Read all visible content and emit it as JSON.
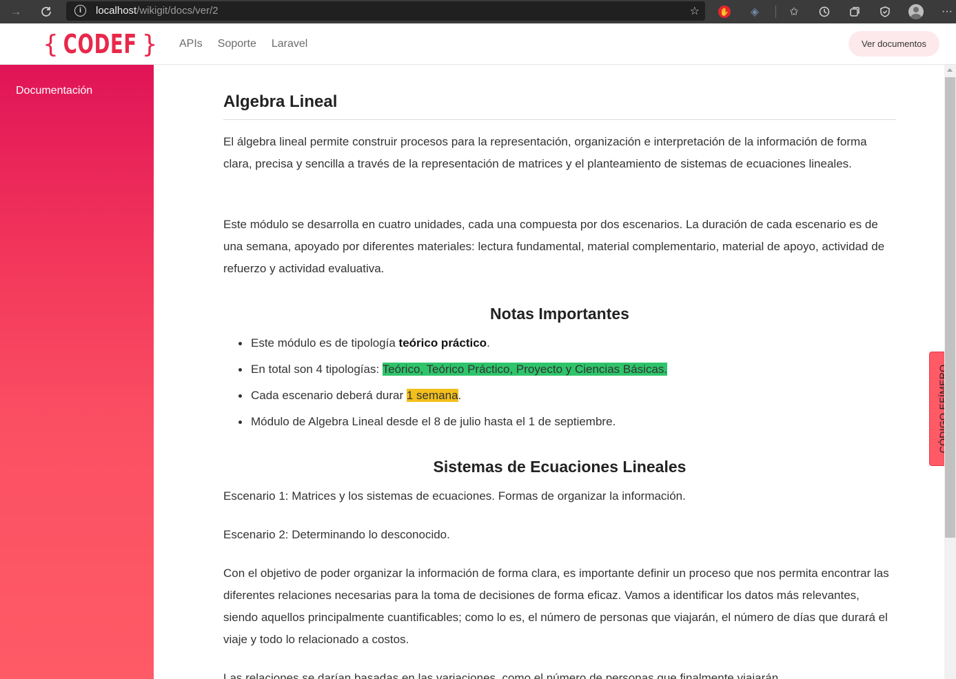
{
  "browser": {
    "url_host": "localhost",
    "url_path": "/wikigit/docs/ver/2",
    "info_icon": "i"
  },
  "header": {
    "logo_text": "CODEF",
    "nav": [
      "APIs",
      "Soporte",
      "Laravel"
    ],
    "ver_documentos": "Ver documentos"
  },
  "sidebar": {
    "items": [
      "Documentación"
    ]
  },
  "side_tab": "CÓDIGO EFÍMERO",
  "main": {
    "title": "Algebra Lineal",
    "intro": "El álgebra lineal permite construir procesos para la representación, organización e interpretación de la información de forma clara, precisa y sencilla a través de la representación de matrices y el planteamiento de sistemas de ecuaciones lineales.",
    "modulo": "Este módulo se desarrolla en cuatro unidades, cada una compuesta por dos escenarios. La duración de cada escenario es de una semana, apoyado por diferentes materiales: lectura fundamental, material complementario, material de apoyo, actividad de refuerzo  y actividad evaluativa.",
    "notas_title": "Notas Importantes",
    "notas": {
      "n1_pre": "Este módulo es de tipología ",
      "n1_bold": "teórico práctico",
      "n1_post": ".",
      "n2_pre": "En total son 4 tipologías: ",
      "n2_hl": "Teórico, Teórico Práctico, Proyecto y Ciencias Básicas.",
      "n3_pre": "Cada escenario deberá durar ",
      "n3_hl": "1 semana",
      "n3_post": ".",
      "n4": "Módulo de Algebra Lineal desde el 8 de julio hasta el 1 de septiembre."
    },
    "sistemas_title": "Sistemas de Ecuaciones Lineales",
    "escenario1": "Escenario 1: Matrices y los sistemas de ecuaciones. Formas de organizar la información.",
    "escenario2": "Escenario 2: Determinando lo desconocido.",
    "objetivo": "Con el objetivo de poder organizar la información de forma clara, es importante definir un proceso que nos permita encontrar las diferentes relaciones necesarias para la toma de decisiones de forma eficaz. Vamos a identificar los datos más relevantes, siendo aquellos principalmente cuantificables; como lo es, el número de personas que viajarán, el número de días que durará el viaje y todo lo relacionado a costos.",
    "relaciones": "Las relaciones se darían basadas en las variaciones, como el número de personas que finalmente viajarán"
  }
}
